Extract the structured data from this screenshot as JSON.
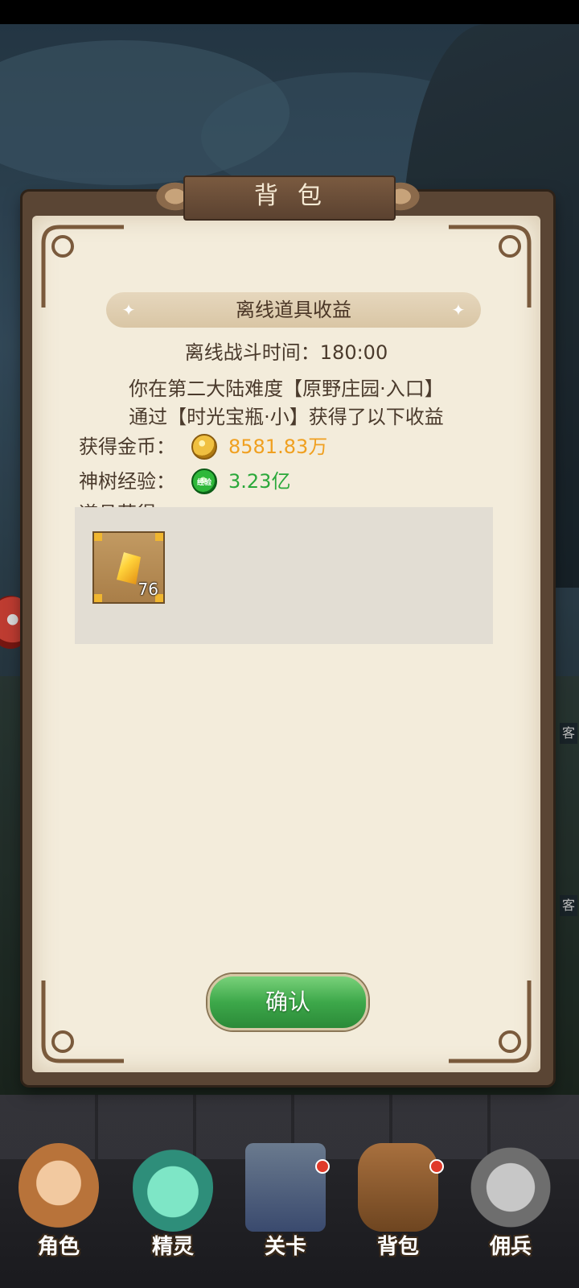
{
  "dialog": {
    "title": "背包",
    "section_title": "离线道具收益",
    "offline_time_label": "离线战斗时间：",
    "offline_time_value": "180:00",
    "info_line1": "你在第二大陆难度【原野庄园·入口】",
    "info_line2": "通过【时光宝瓶·小】获得了以下收益",
    "gold": {
      "label": "获得金币：",
      "icon": "gold-coin-icon",
      "value": "8581.83万",
      "color": "#f0a020"
    },
    "exp": {
      "label": "神树经验：",
      "icon": "exp-potion-icon",
      "icon_text": "经验",
      "value": "3.23亿",
      "color": "#2aa83a"
    },
    "items_label": "道具获得：",
    "items": [
      {
        "icon": "gold-crystal-icon",
        "count": "76"
      }
    ],
    "confirm_label": "确认"
  },
  "side_labels": [
    "客",
    "客"
  ],
  "bottom_nav": [
    {
      "label": "角色",
      "icon": "character-icon"
    },
    {
      "label": "精灵",
      "icon": "spirit-icon"
    },
    {
      "label": "关卡",
      "icon": "stage-icon"
    },
    {
      "label": "背包",
      "icon": "backpack-icon"
    },
    {
      "label": "佣兵",
      "icon": "mercenary-icon"
    }
  ]
}
